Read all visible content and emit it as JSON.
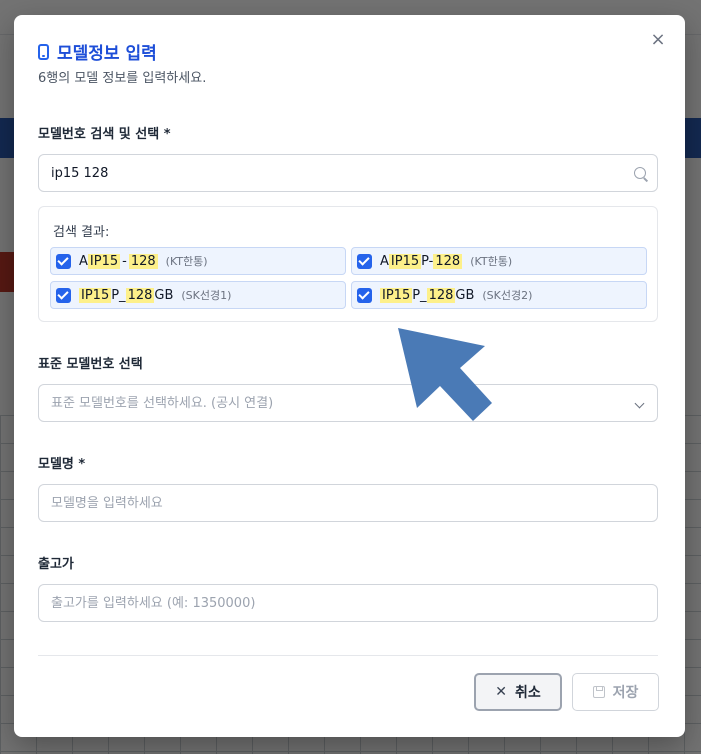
{
  "modal": {
    "title": "모델정보 입력",
    "subtitle": "6행의 모델 정보를 입력하세요.",
    "close_label": "×"
  },
  "search": {
    "label": "모델번호 검색 및 선택 *",
    "value": "ip15 128"
  },
  "results": {
    "label": "검색 결과:",
    "items": [
      {
        "prefix": "A",
        "match1": "IP15",
        "mid": "-",
        "match2": "128",
        "suffix": "",
        "carrier": "(KT한통)",
        "checked": true
      },
      {
        "prefix": "A",
        "match1": "IP15",
        "mid": "P-",
        "match2": "128",
        "suffix": "",
        "carrier": "(KT한통)",
        "checked": true
      },
      {
        "prefix": "",
        "match1": "IP15",
        "mid": "P_",
        "match2": "128",
        "suffix": "GB",
        "carrier": "(SK선경1)",
        "checked": true
      },
      {
        "prefix": "",
        "match1": "IP15",
        "mid": "P_",
        "match2": "128",
        "suffix": "GB",
        "carrier": "(SK선경2)",
        "checked": true
      }
    ]
  },
  "standard_model": {
    "label": "표준 모델번호 선택",
    "placeholder": "표준 모델번호를 선택하세요. (공시 연결)"
  },
  "model_name": {
    "label": "모델명 *",
    "placeholder": "모델명을 입력하세요"
  },
  "release_price": {
    "label": "출고가",
    "placeholder": "출고가를 입력하세요 (예: 1350000)"
  },
  "buttons": {
    "cancel_label": "취소",
    "save_label": "저장"
  },
  "colors": {
    "accent": "#1d4ed8",
    "highlight": "#fdf08a",
    "annotation_arrow": "#4a7ab6"
  }
}
